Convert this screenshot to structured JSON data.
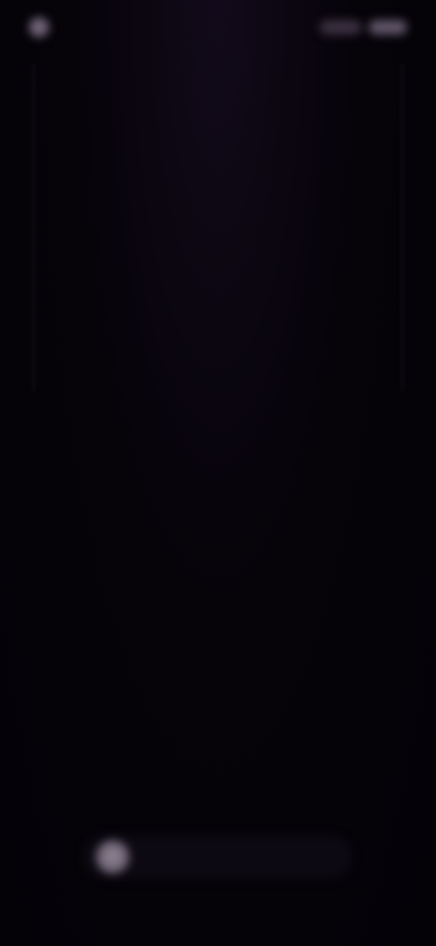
{
  "status_bar": {
    "left_icon": "app-icon",
    "left_text": "",
    "right_text": ""
  },
  "header": {
    "title": ""
  },
  "center": {
    "icon": "faint-glyph",
    "glyph": ""
  },
  "message": {
    "title": "",
    "body": ""
  },
  "input": {
    "icon": "plus-icon",
    "placeholder": ""
  },
  "colors": {
    "background": "#050209",
    "text_bright": "#bcb4c2",
    "text_dim": "#8e8495"
  }
}
